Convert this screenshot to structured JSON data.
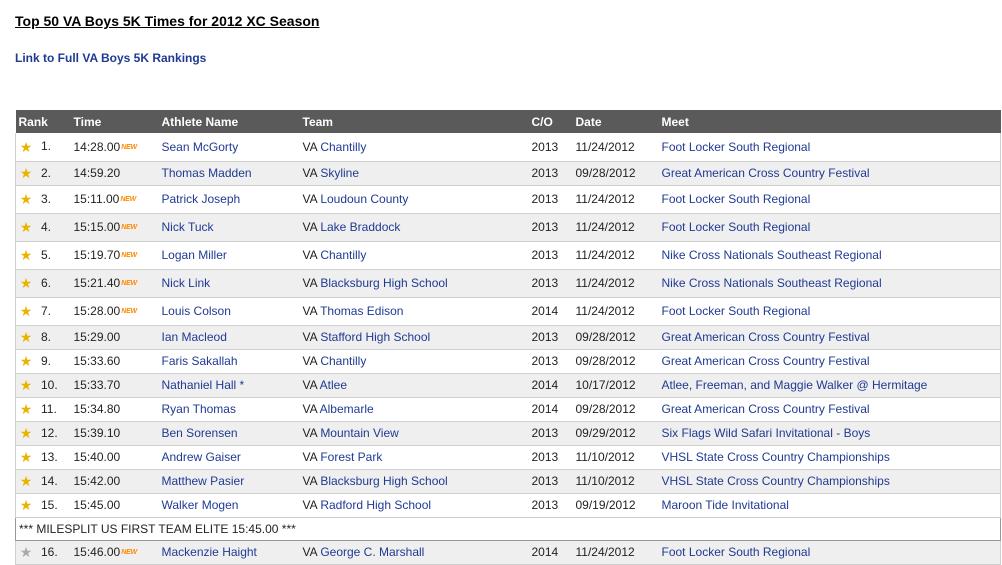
{
  "page": {
    "title": "Top 50 VA Boys 5K Times for 2012 XC Season",
    "full_rankings_link": "Link to Full VA Boys 5K Rankings"
  },
  "table": {
    "headers": {
      "rank": "Rank",
      "time": "Time",
      "athlete": "Athlete Name",
      "team": "Team",
      "class": "C/O",
      "date": "Date",
      "meet": "Meet"
    },
    "new_badge": "NEW",
    "banner": "*** MILESPLIT US FIRST TEAM ELITE 15:45.00 ***",
    "rows": [
      {
        "rank": "1.",
        "time": "14:28.00",
        "is_new": true,
        "athlete": "Sean McGorty",
        "state": "VA",
        "team": "Chantilly",
        "class": "2013",
        "date": "11/24/2012",
        "meet": "Foot Locker South Regional",
        "star": "gold"
      },
      {
        "rank": "2.",
        "time": "14:59.20",
        "is_new": false,
        "athlete": "Thomas Madden",
        "state": "VA",
        "team": "Skyline",
        "class": "2013",
        "date": "09/28/2012",
        "meet": "Great American Cross Country Festival",
        "star": "gold"
      },
      {
        "rank": "3.",
        "time": "15:11.00",
        "is_new": true,
        "athlete": "Patrick Joseph",
        "state": "VA",
        "team": "Loudoun County",
        "class": "2013",
        "date": "11/24/2012",
        "meet": "Foot Locker South Regional",
        "star": "gold"
      },
      {
        "rank": "4.",
        "time": "15:15.00",
        "is_new": true,
        "athlete": "Nick Tuck",
        "state": "VA",
        "team": "Lake Braddock",
        "class": "2013",
        "date": "11/24/2012",
        "meet": "Foot Locker South Regional",
        "star": "gold"
      },
      {
        "rank": "5.",
        "time": "15:19.70",
        "is_new": true,
        "athlete": "Logan Miller",
        "state": "VA",
        "team": "Chantilly",
        "class": "2013",
        "date": "11/24/2012",
        "meet": "Nike Cross Nationals Southeast Regional",
        "star": "gold"
      },
      {
        "rank": "6.",
        "time": "15:21.40",
        "is_new": true,
        "athlete": "Nick Link",
        "state": "VA",
        "team": "Blacksburg High School",
        "class": "2013",
        "date": "11/24/2012",
        "meet": "Nike Cross Nationals Southeast Regional",
        "star": "gold"
      },
      {
        "rank": "7.",
        "time": "15:28.00",
        "is_new": true,
        "athlete": "Louis Colson",
        "state": "VA",
        "team": "Thomas Edison",
        "class": "2014",
        "date": "11/24/2012",
        "meet": "Foot Locker South Regional",
        "star": "gold"
      },
      {
        "rank": "8.",
        "time": "15:29.00",
        "is_new": false,
        "athlete": "Ian Macleod",
        "state": "VA",
        "team": "Stafford High School",
        "class": "2013",
        "date": "09/28/2012",
        "meet": "Great American Cross Country Festival",
        "star": "gold"
      },
      {
        "rank": "9.",
        "time": "15:33.60",
        "is_new": false,
        "athlete": "Faris Sakallah",
        "state": "VA",
        "team": "Chantilly",
        "class": "2013",
        "date": "09/28/2012",
        "meet": "Great American Cross Country Festival",
        "star": "gold"
      },
      {
        "rank": "10.",
        "time": "15:33.70",
        "is_new": false,
        "athlete": "Nathaniel Hall *",
        "state": "VA",
        "team": "Atlee",
        "class": "2014",
        "date": "10/17/2012",
        "meet": "Atlee, Freeman, and Maggie Walker @ Hermitage",
        "star": "gold"
      },
      {
        "rank": "11.",
        "time": "15:34.80",
        "is_new": false,
        "athlete": "Ryan Thomas",
        "state": "VA",
        "team": "Albemarle",
        "class": "2014",
        "date": "09/28/2012",
        "meet": "Great American Cross Country Festival",
        "star": "gold"
      },
      {
        "rank": "12.",
        "time": "15:39.10",
        "is_new": false,
        "athlete": "Ben Sorensen",
        "state": "VA",
        "team": "Mountain View",
        "class": "2013",
        "date": "09/29/2012",
        "meet": "Six Flags Wild Safari Invitational - Boys",
        "star": "gold"
      },
      {
        "rank": "13.",
        "time": "15:40.00",
        "is_new": false,
        "athlete": "Andrew Gaiser",
        "state": "VA",
        "team": "Forest Park",
        "class": "2013",
        "date": "11/10/2012",
        "meet": "VHSL State Cross Country Championships",
        "star": "gold"
      },
      {
        "rank": "14.",
        "time": "15:42.00",
        "is_new": false,
        "athlete": "Matthew Pasier",
        "state": "VA",
        "team": "Blacksburg High School",
        "class": "2013",
        "date": "11/10/2012",
        "meet": "VHSL State Cross Country Championships",
        "star": "gold"
      },
      {
        "rank": "15.",
        "time": "15:45.00",
        "is_new": false,
        "athlete": "Walker Mogen",
        "state": "VA",
        "team": "Radford High School",
        "class": "2013",
        "date": "09/19/2012",
        "meet": "Maroon Tide Invitational",
        "star": "gold"
      },
      {
        "rank": "16.",
        "time": "15:46.00",
        "is_new": true,
        "athlete": "Mackenzie Haight",
        "state": "VA",
        "team": "George C. Marshall",
        "class": "2014",
        "date": "11/24/2012",
        "meet": "Foot Locker South Regional",
        "star": "silver"
      }
    ]
  }
}
